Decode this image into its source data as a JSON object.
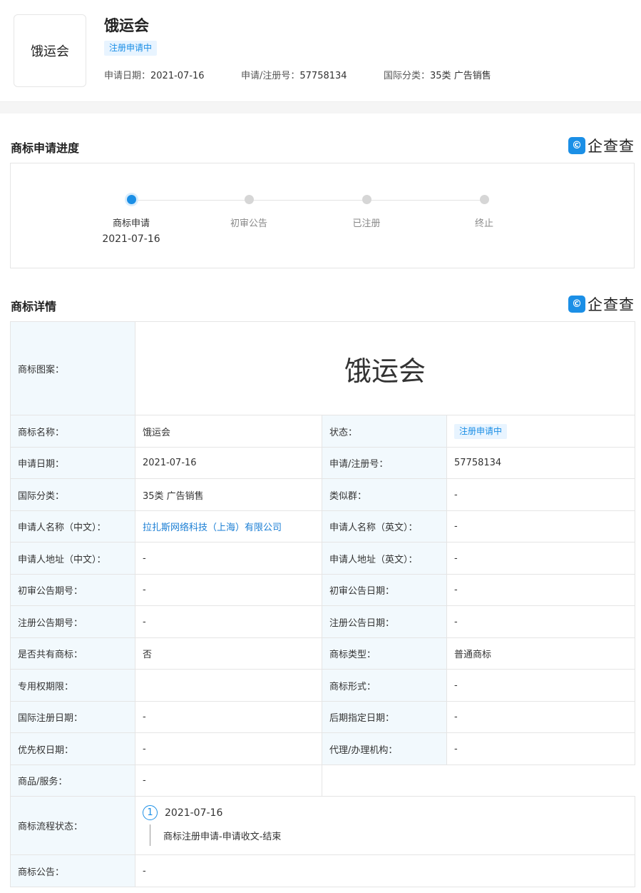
{
  "header": {
    "logo_text": "饿运会",
    "title": "饿运会",
    "status": "注册申请中",
    "meta": [
      {
        "label": "申请日期：",
        "value": "2021-07-16"
      },
      {
        "label": "申请/注册号：",
        "value": "57758134"
      },
      {
        "label": "国际分类：",
        "value": "35类 广告销售"
      }
    ]
  },
  "brand": {
    "badge": "©",
    "text": "企查查"
  },
  "progress": {
    "title": "商标申请进度",
    "steps": [
      {
        "label": "商标申请",
        "date": "2021-07-16",
        "active": true
      },
      {
        "label": "初审公告",
        "date": "",
        "active": false
      },
      {
        "label": "已注册",
        "date": "",
        "active": false
      },
      {
        "label": "终止",
        "date": "",
        "active": false
      }
    ]
  },
  "details": {
    "title": "商标详情",
    "image_label": "商标图案：",
    "image_text": "饿运会",
    "rows": [
      [
        {
          "k": "商标名称：",
          "v": "饿运会"
        },
        {
          "k": "状态：",
          "v": "注册申请中"
        }
      ],
      [
        {
          "k": "申请日期：",
          "v": "2021-07-16"
        },
        {
          "k": "申请/注册号：",
          "v": "57758134"
        }
      ],
      [
        {
          "k": "国际分类：",
          "v": "35类 广告销售"
        },
        {
          "k": "类似群：",
          "v": "-"
        }
      ],
      [
        {
          "k": "申请人名称（中文）：",
          "v": "拉扎斯网络科技（上海）有限公司"
        },
        {
          "k": "申请人名称（英文）：",
          "v": "-"
        }
      ],
      [
        {
          "k": "申请人地址（中文）：",
          "v": "-"
        },
        {
          "k": "申请人地址（英文）：",
          "v": "-"
        }
      ],
      [
        {
          "k": "初审公告期号：",
          "v": "-"
        },
        {
          "k": "初审公告日期：",
          "v": "-"
        }
      ],
      [
        {
          "k": "注册公告期号：",
          "v": "-"
        },
        {
          "k": "注册公告日期：",
          "v": "-"
        }
      ],
      [
        {
          "k": "是否共有商标：",
          "v": "否"
        },
        {
          "k": "商标类型：",
          "v": "普通商标"
        }
      ],
      [
        {
          "k": "专用权期限：",
          "v": ""
        },
        {
          "k": "商标形式：",
          "v": "-"
        }
      ],
      [
        {
          "k": "国际注册日期：",
          "v": "-"
        },
        {
          "k": "后期指定日期：",
          "v": "-"
        }
      ],
      [
        {
          "k": "优先权日期：",
          "v": "-"
        },
        {
          "k": "代理/办理机构：",
          "v": "-"
        }
      ]
    ],
    "goods": {
      "k": "商品/服务：",
      "v": "-"
    },
    "flow": {
      "k": "商标流程状态：",
      "items": [
        {
          "num": "1",
          "date": "2021-07-16",
          "desc": "商标注册申请-申请收文-结束"
        }
      ]
    },
    "notice": {
      "k": "商标公告：",
      "v": "-"
    }
  }
}
